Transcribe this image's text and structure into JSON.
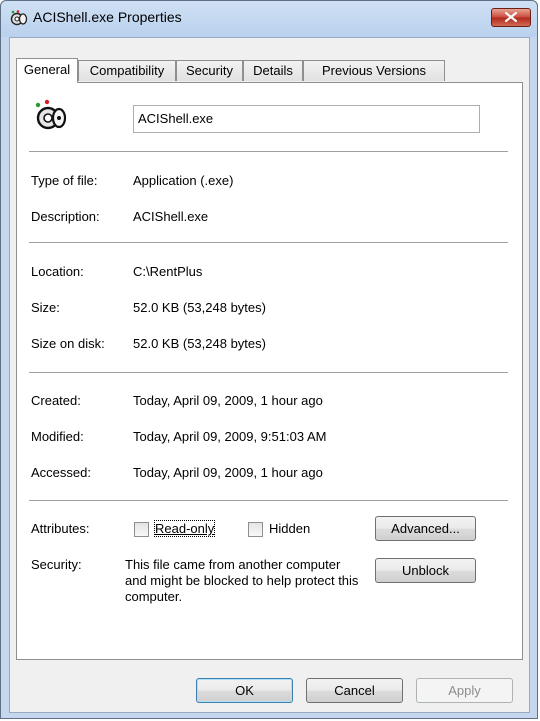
{
  "window": {
    "title": "ACIShell.exe Properties"
  },
  "tabs": [
    {
      "label": "General"
    },
    {
      "label": "Compatibility"
    },
    {
      "label": "Security"
    },
    {
      "label": "Details"
    },
    {
      "label": "Previous Versions"
    }
  ],
  "general": {
    "file_name": "ACIShell.exe",
    "type_label": "Type of file:",
    "type_value": "Application (.exe)",
    "desc_label": "Description:",
    "desc_value": "ACIShell.exe",
    "location_label": "Location:",
    "location_value": "C:\\RentPlus",
    "size_label": "Size:",
    "size_value": "52.0 KB (53,248 bytes)",
    "size_disk_label": "Size on disk:",
    "size_disk_value": "52.0 KB (53,248 bytes)",
    "created_label": "Created:",
    "created_value": "Today, April 09, 2009, 1 hour ago",
    "modified_label": "Modified:",
    "modified_value": "Today, April 09, 2009, 9:51:03 AM",
    "accessed_label": "Accessed:",
    "accessed_value": "Today, April 09, 2009, 1 hour ago",
    "attributes_label": "Attributes:",
    "readonly_label": "Read-only",
    "hidden_label": "Hidden",
    "advanced_label": "Advanced...",
    "security_label": "Security:",
    "security_text": "This file came from another computer and might be blocked to help protect this computer.",
    "unblock_label": "Unblock"
  },
  "footer": {
    "ok_label": "OK",
    "cancel_label": "Cancel",
    "apply_label": "Apply"
  }
}
